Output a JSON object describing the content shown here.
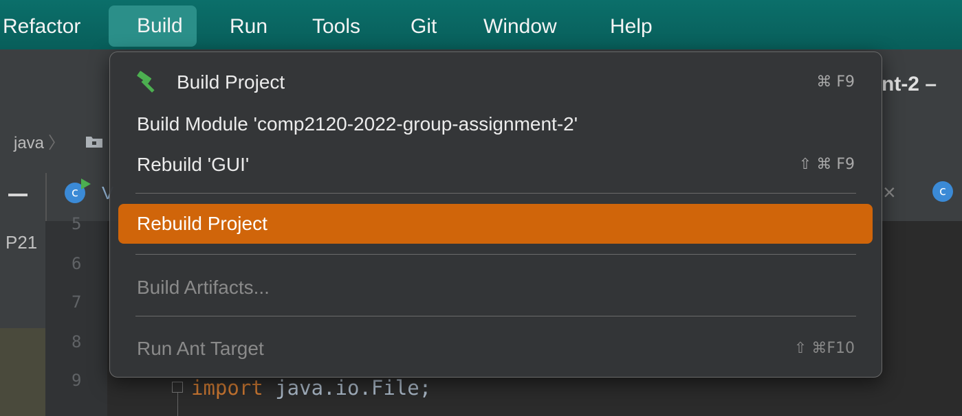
{
  "menubar": {
    "items": [
      {
        "label": "Refactor"
      },
      {
        "label": "Build"
      },
      {
        "label": "Run"
      },
      {
        "label": "Tools"
      },
      {
        "label": "Git"
      },
      {
        "label": "Window"
      },
      {
        "label": "Help"
      }
    ],
    "active_item": "Build"
  },
  "background": {
    "window_title_fragment": "nt-2 –",
    "breadcrumb": {
      "segment": "java",
      "separator": "〉"
    },
    "tab_label_fragment": "V",
    "side_label": "P21",
    "line_numbers": [
      "5",
      "6",
      "7",
      "8",
      "9"
    ],
    "code": {
      "keyword": "import",
      "rest": " java.io.File;"
    },
    "file_icon_letter": "c",
    "tab_close": "×"
  },
  "build_menu": {
    "items": [
      {
        "label": "Build Project",
        "shortcut": "⌘ F9",
        "icon": "hammer-icon",
        "state": "normal"
      },
      {
        "label": "Build Module 'comp2120-2022-group-assignment-2'",
        "shortcut": "",
        "state": "normal"
      },
      {
        "label": "Rebuild 'GUI'",
        "shortcut": "⇧ ⌘ F9",
        "state": "normal"
      },
      {
        "label": "Rebuild Project",
        "shortcut": "",
        "state": "highlighted"
      },
      {
        "label": "Build Artifacts...",
        "shortcut": "",
        "state": "disabled"
      },
      {
        "label": "Run Ant Target",
        "shortcut": "⇧ ⌘F10",
        "state": "disabled"
      }
    ]
  },
  "colors": {
    "menubar_bg": "#0b6f6a",
    "highlight": "#d0650a",
    "hammer": "#4caf50"
  }
}
